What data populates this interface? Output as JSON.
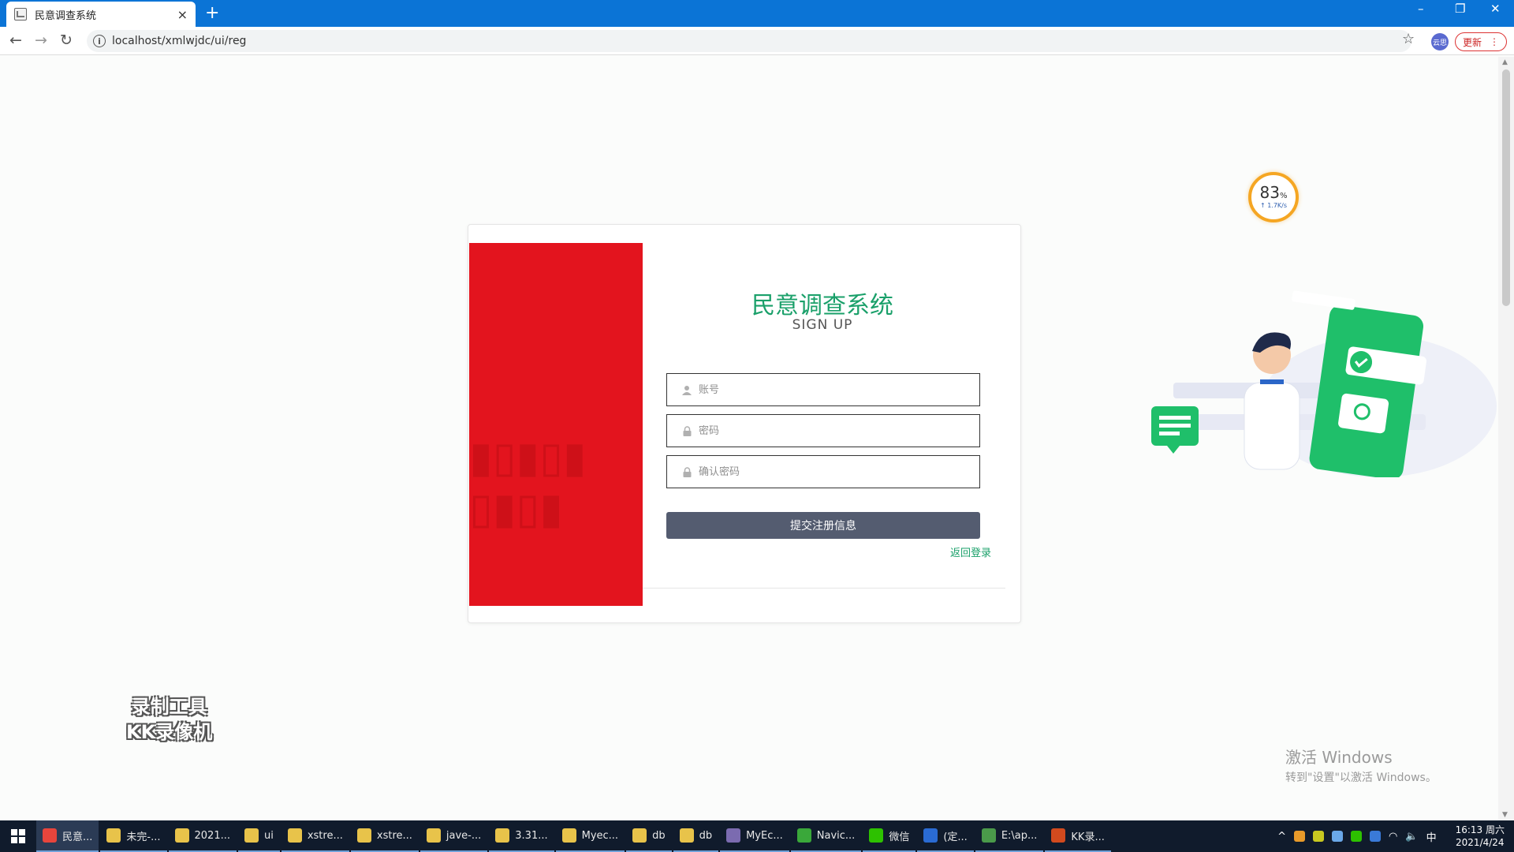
{
  "browser": {
    "tab_title": "民意调查系统",
    "tab_close": "×",
    "new_tab": "+",
    "url": "localhost/xmlwjdc/ui/reg",
    "ext_label": "云思",
    "update_label": "更新",
    "win_min": "–",
    "win_restore": "❐",
    "win_close": "✕"
  },
  "form": {
    "title": "民意调查系统",
    "subtitle": "SIGN UP",
    "account_placeholder": "账号",
    "password_placeholder": "密码",
    "confirm_placeholder": "确认密码",
    "submit_label": "提交注册信息",
    "back_login": "返回登录"
  },
  "colors": {
    "accent_green": "#1aa06a",
    "red_panel": "#e3141e",
    "submit_button": "#545c70",
    "titlebar": "#0b74d6"
  },
  "speed_widget": {
    "percent": "83",
    "percent_unit": "%",
    "rate": "↑ 1.7K/s"
  },
  "watermarks": {
    "kk_line1": "录制工具",
    "kk_line2": "KK录像机",
    "win_line1": "激活 Windows",
    "win_line2": "转到\"设置\"以激活 Windows。"
  },
  "taskbar": {
    "items": [
      {
        "label": "民意...",
        "icon": "chrome-icon",
        "color": "#e8453c"
      },
      {
        "label": "未完-...",
        "icon": "folder-icon",
        "color": "#e8c34a"
      },
      {
        "label": "2021...",
        "icon": "folder-icon",
        "color": "#e8c34a"
      },
      {
        "label": "ui",
        "icon": "folder-icon",
        "color": "#e8c34a"
      },
      {
        "label": "xstre...",
        "icon": "folder-icon",
        "color": "#e8c34a"
      },
      {
        "label": "xstre...",
        "icon": "folder-icon",
        "color": "#e8c34a"
      },
      {
        "label": "jave-...",
        "icon": "folder-icon",
        "color": "#e8c34a"
      },
      {
        "label": "3.31...",
        "icon": "folder-icon",
        "color": "#e8c34a"
      },
      {
        "label": "Myec...",
        "icon": "folder-icon",
        "color": "#e8c34a"
      },
      {
        "label": "db",
        "icon": "folder-icon",
        "color": "#e8c34a"
      },
      {
        "label": "db",
        "icon": "folder-icon",
        "color": "#e8c34a"
      },
      {
        "label": "MyEc...",
        "icon": "eclipse-icon",
        "color": "#7b6bb0"
      },
      {
        "label": "Navic...",
        "icon": "navicat-icon",
        "color": "#3aa83a"
      },
      {
        "label": "微信",
        "icon": "wechat-icon",
        "color": "#2dc100"
      },
      {
        "label": "(定...",
        "icon": "editor-icon",
        "color": "#2a6bd3"
      },
      {
        "label": "E:\\ap...",
        "icon": "notepad-icon",
        "color": "#4a9a4a"
      },
      {
        "label": "KK录...",
        "icon": "kk-icon",
        "color": "#d24a1e"
      }
    ],
    "ime": "中",
    "time": "16:13 周六",
    "date": "2021/4/24"
  }
}
